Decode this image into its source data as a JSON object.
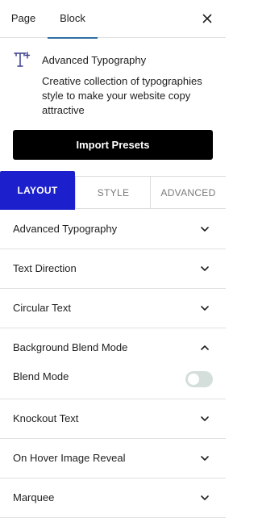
{
  "tabs_top": {
    "page_label": "Page",
    "block_label": "Block",
    "active": "Block"
  },
  "block": {
    "icon": "advanced-typography-icon",
    "title": "Advanced Typography",
    "description": "Creative collection of typographies style to make your website copy attractive",
    "import_button": "Import Presets"
  },
  "tabs": {
    "layout": "LAYOUT",
    "style": "STYLE",
    "advanced": "ADVANCED",
    "active": "LAYOUT"
  },
  "sections": {
    "advanced_typography": "Advanced Typography",
    "text_direction": "Text Direction",
    "circular_text": "Circular Text",
    "background_blend_mode": "Background Blend Mode",
    "knockout_text": "Knockout Text",
    "on_hover_image_reveal": "On Hover Image Reveal",
    "marquee": "Marquee"
  },
  "blend": {
    "label": "Blend Mode",
    "enabled": false
  },
  "colors": {
    "accent": "#1c1fcc",
    "active_underline": "#2f6fa3",
    "icon_color": "#3b3f8f"
  }
}
